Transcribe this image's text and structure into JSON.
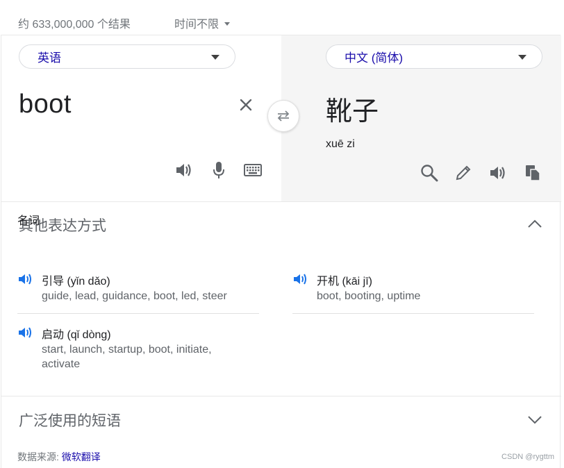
{
  "topbar": {
    "result_count": "约 633,000,000 个结果",
    "time_filter": "时间不限"
  },
  "translator": {
    "source_lang": "英语",
    "target_lang": "中文 (简体)",
    "source_text": "boot",
    "target_text": "靴子",
    "pinyin": "xuē zi"
  },
  "other_expressions": {
    "title": "其他表达方式",
    "part_of_speech": "名词",
    "entries": [
      {
        "term": "引导 (yǐn dǎo)",
        "synonyms": "guide, lead, guidance, boot, led, steer"
      },
      {
        "term": "开机 (kāi jī)",
        "synonyms": "boot, booting, uptime"
      },
      {
        "term": "启动 (qǐ dòng)",
        "synonyms": "start, launch, startup, boot, initiate, activate"
      }
    ]
  },
  "phrases": {
    "title": "广泛使用的短语"
  },
  "footer": {
    "source_label": "数据来源:",
    "source_link": "微软翻译",
    "watermark": "CSDN @rygttm"
  },
  "colors": {
    "link": "#1a0dab",
    "speaker_accent": "#1a73e8",
    "icon_gray": "#5f6368"
  }
}
